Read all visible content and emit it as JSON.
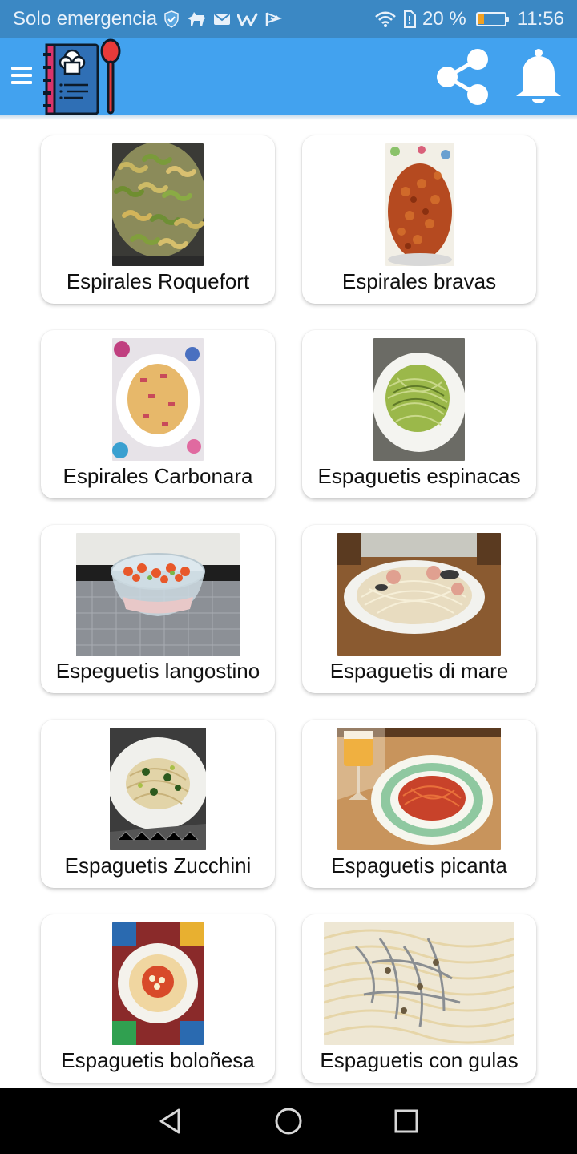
{
  "status_bar": {
    "carrier": "Solo emergencia",
    "battery_text": "20 %",
    "battery_level": 0.2,
    "time": "11:56",
    "icons": [
      "vpn-shield-icon",
      "dog-icon",
      "mail-icon",
      "w-icon",
      "flag-icon",
      "wifi-icon",
      "sim-icon",
      "battery-icon"
    ]
  },
  "app_bar": {
    "icons": [
      "menu-icon",
      "recipe-book-logo",
      "share-icon",
      "bell-icon"
    ]
  },
  "colors": {
    "status_bar": "#3b88c4",
    "app_bar": "#42a2ef",
    "nav_bar": "#000000"
  },
  "recipes": [
    {
      "title": "Espirales Roquefort"
    },
    {
      "title": "Espirales bravas"
    },
    {
      "title": "Espirales Carbonara"
    },
    {
      "title": "Espaguetis espinacas"
    },
    {
      "title": "Espeguetis langostino"
    },
    {
      "title": "Espaguetis di mare"
    },
    {
      "title": "Espaguetis Zucchini"
    },
    {
      "title": "Espaguetis picanta"
    },
    {
      "title": "Espaguetis boloñesa"
    },
    {
      "title": "Espaguetis con gulas"
    }
  ],
  "nav_bar": {
    "icons": [
      "back-icon",
      "home-icon",
      "recents-icon"
    ]
  }
}
